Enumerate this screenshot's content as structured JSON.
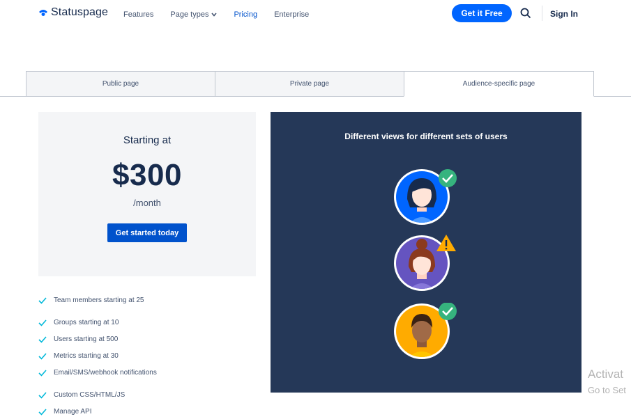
{
  "header": {
    "logo_text": "Statuspage",
    "nav": [
      {
        "label": "Features"
      },
      {
        "label": "Page types"
      },
      {
        "label": "Pricing"
      },
      {
        "label": "Enterprise"
      }
    ],
    "cta_label": "Get it Free",
    "signin_label": "Sign In"
  },
  "tabs": [
    {
      "label": "Public page"
    },
    {
      "label": "Private page"
    },
    {
      "label": "Audience-specific page"
    }
  ],
  "pricing": {
    "starting_label": "Starting at",
    "price": "$300",
    "period": "/month",
    "button_label": "Get started today"
  },
  "features": [
    "Team members starting at 25",
    "Groups starting at 10",
    "Users starting at 500",
    "Metrics starting at 30",
    "Email/SMS/webhook notifications",
    "Custom CSS/HTML/JS",
    "Manage API"
  ],
  "illustration": {
    "title": "Different views for different sets of users",
    "avatars": [
      {
        "name": "user-1",
        "status": "check"
      },
      {
        "name": "user-2",
        "status": "warning"
      },
      {
        "name": "user-3",
        "status": "check"
      }
    ]
  },
  "watermark": {
    "line1": "Activat",
    "line2": "Go to Set"
  },
  "colors": {
    "brand": "#0052cc",
    "cta": "#0065ff",
    "panel": "#253858",
    "check": "#36b37e",
    "warning": "#ffab00"
  }
}
